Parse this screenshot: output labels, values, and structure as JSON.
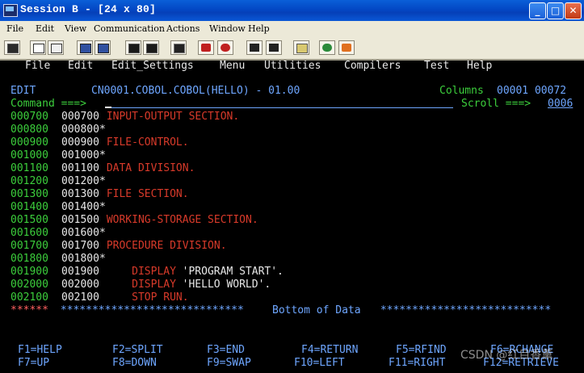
{
  "window": {
    "title": "Session B - [24 x 80]"
  },
  "menubar": [
    "File",
    "Edit",
    "View",
    "Communication",
    "Actions",
    "Window",
    "Help"
  ],
  "toolbar_icons": [
    "print-screen-icon",
    "copy-icon",
    "paste-icon",
    "send-icon",
    "receive-icon",
    "display-icon",
    "keyboard-icon",
    "record-macro-icon",
    "stop-macro-icon",
    "play-macro-icon",
    "pause-macro-icon",
    "clipboard-icon",
    "globe-icon",
    "help-icon"
  ],
  "ispf_menu": [
    "File",
    "Edit",
    "Edit_Settings",
    "Menu",
    "Utilities",
    "Compilers",
    "Test",
    "Help"
  ],
  "header": {
    "mode": "EDIT",
    "dataset": "CN0001.COBOL.COBOL(HELLO) - 01.00",
    "columns_label": "Columns",
    "columns_value": "00001 00072",
    "command_label": "Command ===>",
    "scroll_label": "Scroll ===>",
    "scroll_value": "0006"
  },
  "lines": [
    {
      "num": "000700",
      "seq": "000700",
      "text": " INPUT-OUTPUT SECTION."
    },
    {
      "num": "000800",
      "seq": "000800*",
      "text": ""
    },
    {
      "num": "000900",
      "seq": "000900",
      "text": " FILE-CONTROL."
    },
    {
      "num": "001000",
      "seq": "001000*",
      "text": ""
    },
    {
      "num": "001100",
      "seq": "001100",
      "text": " DATA DIVISION."
    },
    {
      "num": "001200",
      "seq": "001200*",
      "text": ""
    },
    {
      "num": "001300",
      "seq": "001300",
      "text": " FILE SECTION."
    },
    {
      "num": "001400",
      "seq": "001400*",
      "text": ""
    },
    {
      "num": "001500",
      "seq": "001500",
      "text": " WORKING-STORAGE SECTION."
    },
    {
      "num": "001600",
      "seq": "001600*",
      "text": ""
    },
    {
      "num": "001700",
      "seq": "001700",
      "text": " PROCEDURE DIVISION."
    },
    {
      "num": "001800",
      "seq": "001800*",
      "text": ""
    },
    {
      "num": "001900",
      "seq": "001900",
      "text": "     DISPLAY ",
      "str": "'PROGRAM START'."
    },
    {
      "num": "002000",
      "seq": "002000",
      "text": "     DISPLAY ",
      "str": "'HELLO WORLD'."
    },
    {
      "num": "002100",
      "seq": "002100",
      "text": "     STOP RUN."
    }
  ],
  "bottom": {
    "stars_left": "******",
    "stars_mid": " ***************************** ",
    "label": "Bottom of Data",
    "stars_right": " ***************************"
  },
  "pfkeys_row1": [
    "F1=HELP",
    "F2=SPLIT",
    "F3=END",
    "F4=RETURN",
    "F5=RFIND",
    "F6=RCHANGE"
  ],
  "pfkeys_row2": [
    "F7=UP",
    "F8=DOWN",
    "F9=SWAP",
    "F10=LEFT",
    "F11=RIGHT",
    "F12=RETRIEVE"
  ],
  "watermark": "CSDN @红目香薰"
}
